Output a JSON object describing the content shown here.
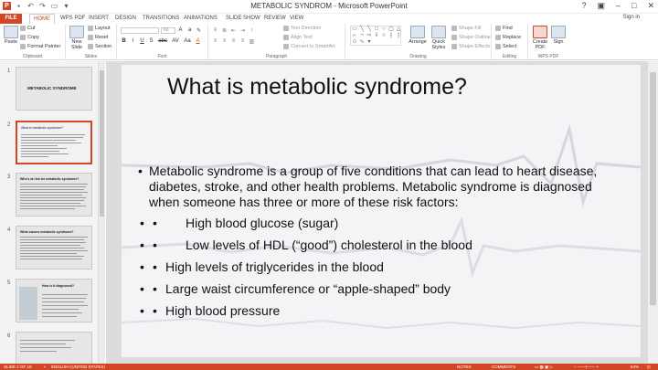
{
  "window": {
    "title": "METABOLIC SYNDROM - Microsoft PowerPoint",
    "help": "?",
    "sign_in": "Sign in"
  },
  "tabs": [
    "FILE",
    "HOME",
    "WPS PDF",
    "INSERT",
    "DESIGN",
    "TRANSITIONS",
    "ANIMATIONS",
    "SLIDE SHOW",
    "REVIEW",
    "VIEW"
  ],
  "active_tab": "HOME",
  "ribbon": {
    "clipboard": {
      "label": "Clipboard",
      "paste": "Paste",
      "cut": "Cut",
      "copy": "Copy",
      "format_painter": "Format Painter"
    },
    "slides": {
      "label": "Slides",
      "new_slide": "New Slide",
      "layout": "Layout",
      "reset": "Reset",
      "section": "Section"
    },
    "font": {
      "label": "Font",
      "font_size": "66",
      "buttons": [
        "B",
        "I",
        "U",
        "S",
        "abc",
        "AV",
        "Aa",
        "A"
      ]
    },
    "paragraph": {
      "label": "Paragraph",
      "text_direction": "Text Direction",
      "align_text": "Align Text",
      "convert_smartart": "Convert to SmartArt"
    },
    "drawing": {
      "label": "Drawing",
      "arrange": "Arrange",
      "quick_styles": "Quick Styles",
      "shape_fill": "Shape Fill",
      "shape_outline": "Shape Outline",
      "shape_effects": "Shape Effects"
    },
    "editing": {
      "label": "Editing",
      "find": "Find",
      "replace": "Replace",
      "select": "Select"
    },
    "wps_pdf": {
      "label": "WPS PDF",
      "create_pdf": "Create PDF",
      "sign": "Sign"
    }
  },
  "thumbnails": [
    {
      "num": "1",
      "title": "METABOLIC SYNDROME"
    },
    {
      "num": "2",
      "title": "What is metabolic syndrome?"
    },
    {
      "num": "3",
      "title": "Who's at risk for metabolic syndrome?"
    },
    {
      "num": "4",
      "title": "What causes metabolic syndrome?"
    },
    {
      "num": "5",
      "title": "How is it diagnosed?"
    },
    {
      "num": "6",
      "title": ""
    }
  ],
  "slide": {
    "title": "What is metabolic syndrome?",
    "intro": "Metabolic syndrome is a group of five conditions that can lead to heart disease, diabetes, stroke, and other health problems. Metabolic syndrome is diagnosed when someone has three or more of these risk factors:",
    "bullet_char": "•",
    "bullets": [
      "High blood glucose (sugar)",
      "Low levels of HDL (“good”) cholesterol in the blood",
      "High levels of triglycerides in the blood",
      "Large waist circumference or “apple-shaped” body",
      "High blood pressure"
    ]
  },
  "statusbar": {
    "slide_info": "SLIDE 2 OF 19",
    "language": "ENGLISH (UNITED STATES)",
    "notes": "NOTES",
    "comments": "COMMENTS",
    "zoom": "54%"
  },
  "colors": {
    "accent": "#d24726",
    "slide_bg": "#f4f4f7"
  }
}
